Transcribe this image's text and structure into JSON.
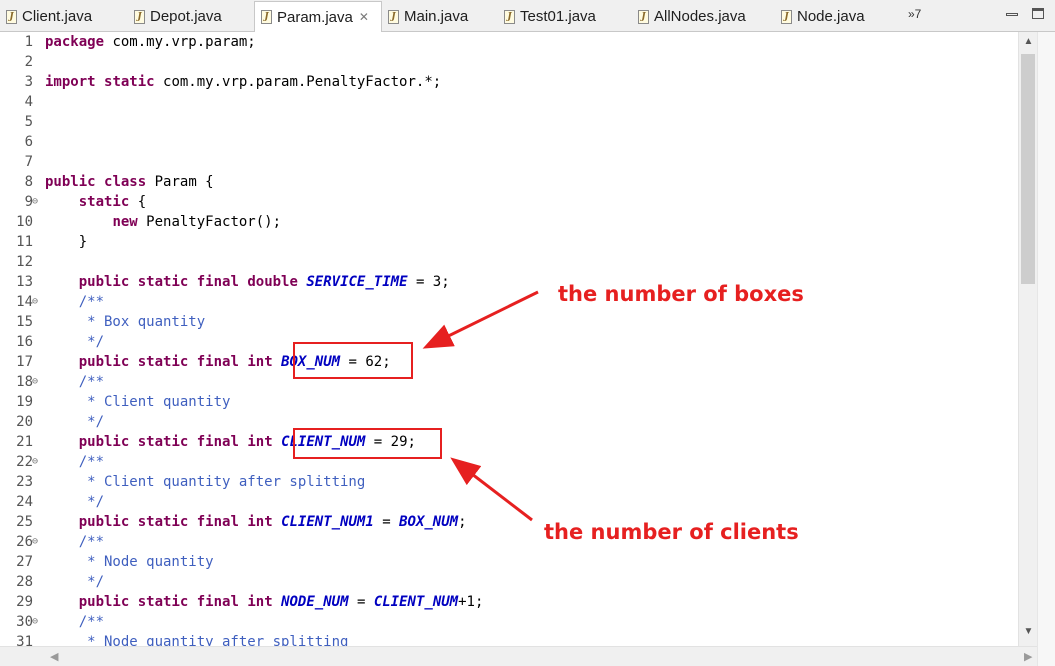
{
  "tabs": [
    {
      "label": "Client.java",
      "active": false,
      "closable": false
    },
    {
      "label": "Depot.java",
      "active": false,
      "closable": false
    },
    {
      "label": "Param.java",
      "active": true,
      "closable": true
    },
    {
      "label": "Main.java",
      "active": false,
      "closable": false
    },
    {
      "label": "Test01.java",
      "active": false,
      "closable": false
    },
    {
      "label": "AllNodes.java",
      "active": false,
      "closable": false
    },
    {
      "label": "Node.java",
      "active": false,
      "closable": false
    }
  ],
  "tab_icon_glyph": "J",
  "tab_close_glyph": "✕",
  "tab_overflow": "»7",
  "editor": {
    "lines": [
      {
        "n": "1",
        "fold": false,
        "tokens": [
          {
            "c": "kw",
            "t": "package"
          },
          {
            "c": "",
            "t": " com.my.vrp.param;"
          }
        ]
      },
      {
        "n": "2",
        "fold": false,
        "tokens": []
      },
      {
        "n": "3",
        "fold": false,
        "tokens": [
          {
            "c": "kw",
            "t": "import"
          },
          {
            "c": "",
            "t": " "
          },
          {
            "c": "kw",
            "t": "static"
          },
          {
            "c": "",
            "t": " com.my.vrp.param.PenaltyFactor.*;"
          }
        ]
      },
      {
        "n": "4",
        "fold": false,
        "tokens": []
      },
      {
        "n": "5",
        "fold": false,
        "tokens": []
      },
      {
        "n": "6",
        "fold": false,
        "tokens": []
      },
      {
        "n": "7",
        "fold": false,
        "tokens": []
      },
      {
        "n": "8",
        "fold": false,
        "tokens": [
          {
            "c": "kw",
            "t": "public"
          },
          {
            "c": "",
            "t": " "
          },
          {
            "c": "kw",
            "t": "class"
          },
          {
            "c": "",
            "t": " Param {"
          }
        ]
      },
      {
        "n": "9",
        "fold": true,
        "tokens": [
          {
            "c": "",
            "t": "    "
          },
          {
            "c": "kw",
            "t": "static"
          },
          {
            "c": "",
            "t": " {"
          }
        ]
      },
      {
        "n": "10",
        "fold": false,
        "tokens": [
          {
            "c": "",
            "t": "        "
          },
          {
            "c": "kw",
            "t": "new"
          },
          {
            "c": "",
            "t": " PenaltyFactor();"
          }
        ]
      },
      {
        "n": "11",
        "fold": false,
        "tokens": [
          {
            "c": "",
            "t": "    }"
          }
        ]
      },
      {
        "n": "12",
        "fold": false,
        "tokens": []
      },
      {
        "n": "13",
        "fold": false,
        "tokens": [
          {
            "c": "",
            "t": "    "
          },
          {
            "c": "kw",
            "t": "public"
          },
          {
            "c": "",
            "t": " "
          },
          {
            "c": "kw",
            "t": "static"
          },
          {
            "c": "",
            "t": " "
          },
          {
            "c": "kw",
            "t": "final"
          },
          {
            "c": "",
            "t": " "
          },
          {
            "c": "kw",
            "t": "double"
          },
          {
            "c": "",
            "t": " "
          },
          {
            "c": "cst",
            "t": "SERVICE_TIME"
          },
          {
            "c": "",
            "t": " = 3;"
          }
        ]
      },
      {
        "n": "14",
        "fold": true,
        "tokens": [
          {
            "c": "cm",
            "t": "    /**"
          }
        ]
      },
      {
        "n": "15",
        "fold": false,
        "tokens": [
          {
            "c": "cm",
            "t": "     * Box quantity"
          }
        ]
      },
      {
        "n": "16",
        "fold": false,
        "tokens": [
          {
            "c": "cm",
            "t": "     */"
          }
        ]
      },
      {
        "n": "17",
        "fold": false,
        "tokens": [
          {
            "c": "",
            "t": "    "
          },
          {
            "c": "kw",
            "t": "public"
          },
          {
            "c": "",
            "t": " "
          },
          {
            "c": "kw",
            "t": "static"
          },
          {
            "c": "",
            "t": " "
          },
          {
            "c": "kw",
            "t": "final"
          },
          {
            "c": "",
            "t": " "
          },
          {
            "c": "kw",
            "t": "int"
          },
          {
            "c": "",
            "t": " "
          },
          {
            "c": "cst",
            "t": "BOX_NUM"
          },
          {
            "c": "",
            "t": " = 62;"
          }
        ]
      },
      {
        "n": "18",
        "fold": true,
        "tokens": [
          {
            "c": "cm",
            "t": "    /**"
          }
        ]
      },
      {
        "n": "19",
        "fold": false,
        "tokens": [
          {
            "c": "cm",
            "t": "     * Client quantity"
          }
        ]
      },
      {
        "n": "20",
        "fold": false,
        "tokens": [
          {
            "c": "cm",
            "t": "     */"
          }
        ]
      },
      {
        "n": "21",
        "fold": false,
        "tokens": [
          {
            "c": "",
            "t": "    "
          },
          {
            "c": "kw",
            "t": "public"
          },
          {
            "c": "",
            "t": " "
          },
          {
            "c": "kw",
            "t": "static"
          },
          {
            "c": "",
            "t": " "
          },
          {
            "c": "kw",
            "t": "final"
          },
          {
            "c": "",
            "t": " "
          },
          {
            "c": "kw",
            "t": "int"
          },
          {
            "c": "",
            "t": " "
          },
          {
            "c": "cst",
            "t": "CLIENT_NUM"
          },
          {
            "c": "",
            "t": " = 29;"
          }
        ]
      },
      {
        "n": "22",
        "fold": true,
        "tokens": [
          {
            "c": "cm",
            "t": "    /**"
          }
        ]
      },
      {
        "n": "23",
        "fold": false,
        "tokens": [
          {
            "c": "cm",
            "t": "     * Client quantity after splitting"
          }
        ]
      },
      {
        "n": "24",
        "fold": false,
        "tokens": [
          {
            "c": "cm",
            "t": "     */"
          }
        ]
      },
      {
        "n": "25",
        "fold": false,
        "tokens": [
          {
            "c": "",
            "t": "    "
          },
          {
            "c": "kw",
            "t": "public"
          },
          {
            "c": "",
            "t": " "
          },
          {
            "c": "kw",
            "t": "static"
          },
          {
            "c": "",
            "t": " "
          },
          {
            "c": "kw",
            "t": "final"
          },
          {
            "c": "",
            "t": " "
          },
          {
            "c": "kw",
            "t": "int"
          },
          {
            "c": "",
            "t": " "
          },
          {
            "c": "cst",
            "t": "CLIENT_NUM1"
          },
          {
            "c": "",
            "t": " = "
          },
          {
            "c": "cst",
            "t": "BOX_NUM"
          },
          {
            "c": "",
            "t": ";"
          }
        ]
      },
      {
        "n": "26",
        "fold": true,
        "tokens": [
          {
            "c": "cm",
            "t": "    /**"
          }
        ]
      },
      {
        "n": "27",
        "fold": false,
        "tokens": [
          {
            "c": "cm",
            "t": "     * Node quantity"
          }
        ]
      },
      {
        "n": "28",
        "fold": false,
        "tokens": [
          {
            "c": "cm",
            "t": "     */"
          }
        ]
      },
      {
        "n": "29",
        "fold": false,
        "tokens": [
          {
            "c": "",
            "t": "    "
          },
          {
            "c": "kw",
            "t": "public"
          },
          {
            "c": "",
            "t": " "
          },
          {
            "c": "kw",
            "t": "static"
          },
          {
            "c": "",
            "t": " "
          },
          {
            "c": "kw",
            "t": "final"
          },
          {
            "c": "",
            "t": " "
          },
          {
            "c": "kw",
            "t": "int"
          },
          {
            "c": "",
            "t": " "
          },
          {
            "c": "cst",
            "t": "NODE_NUM"
          },
          {
            "c": "",
            "t": " = "
          },
          {
            "c": "cst",
            "t": "CLIENT_NUM"
          },
          {
            "c": "",
            "t": "+1;"
          }
        ]
      },
      {
        "n": "30",
        "fold": true,
        "tokens": [
          {
            "c": "cm",
            "t": "    /**"
          }
        ]
      },
      {
        "n": "31",
        "fold": false,
        "tokens": [
          {
            "c": "cm",
            "t": "     * Node quantity after splitting"
          }
        ]
      }
    ]
  },
  "annotations": {
    "boxes_label": "the number of boxes",
    "clients_label": "the number of clients"
  },
  "colors": {
    "keyword": "#7f0055",
    "comment": "#3f5fbf",
    "constant": "#0000c0",
    "annotation": "#e62020"
  }
}
